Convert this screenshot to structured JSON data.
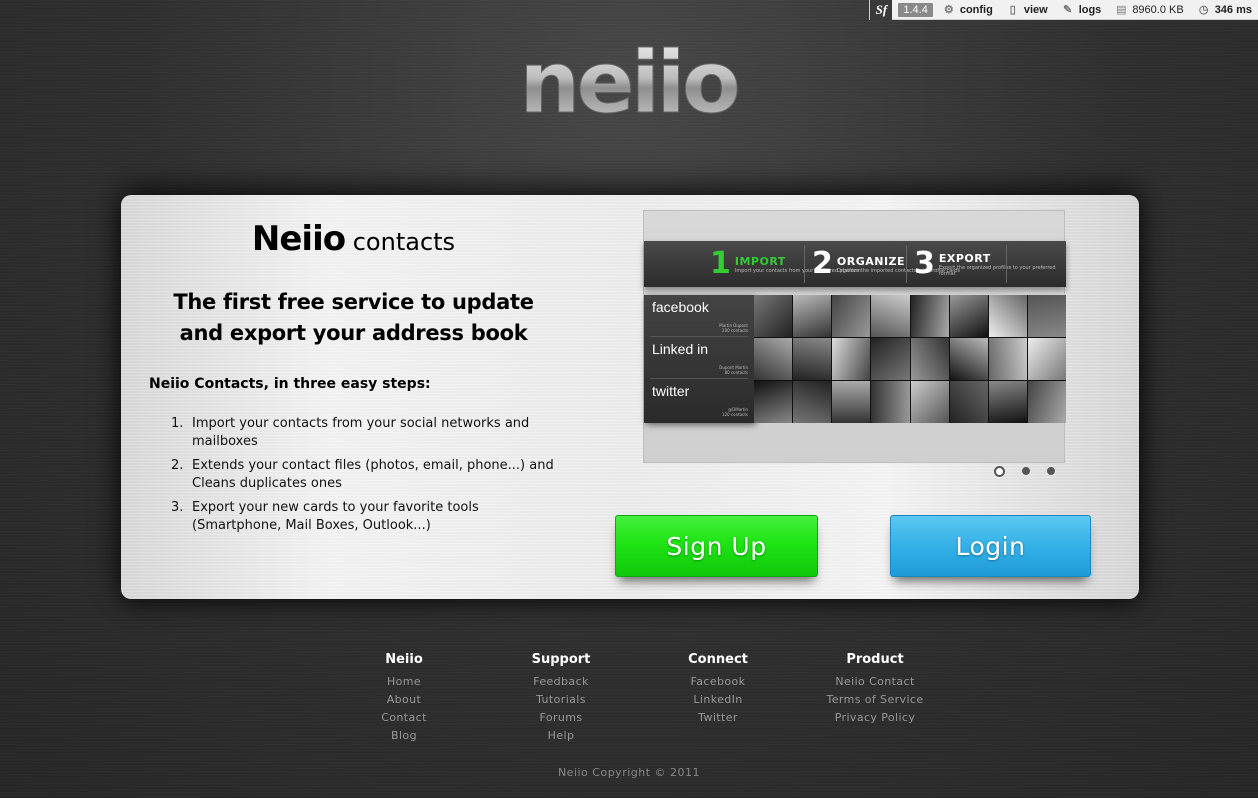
{
  "debug_toolbar": {
    "logo": "Sf",
    "version": "1.4.4",
    "config": "config",
    "view": "view",
    "logs": "logs",
    "memory": "8960.0 KB",
    "time": "346 ms"
  },
  "brand": {
    "logo_text": "neiio"
  },
  "panel": {
    "title_big": "Neiio",
    "title_small": " contacts",
    "headline": "The first free service to update and export your address book",
    "steps_title": "Neiio Contacts, in three easy steps:",
    "steps": [
      {
        "num": "1.",
        "text": "Import your contacts from your social networks and mailboxes"
      },
      {
        "num": "2.",
        "text": "Extends your contact files (photos, email, phone...) and Cleans duplicates ones"
      },
      {
        "num": "3.",
        "text": "Export your new cards to your favorite tools (Smartphone, Mail Boxes, Outlook...)"
      }
    ]
  },
  "slideshow": {
    "steps": [
      {
        "num": "1",
        "title": "Import",
        "sub": "Import your contacts from your preferred platform"
      },
      {
        "num": "2",
        "title": "Organize",
        "sub": "Organize the imported contacts into profile cards"
      },
      {
        "num": "3",
        "title": "Export",
        "sub": "Export the organized profiles to your preferred format"
      }
    ],
    "networks": [
      {
        "name": "facebook",
        "sub1": "Martin Dupont",
        "sub2": "200 contacts"
      },
      {
        "name": "Linked in",
        "sub1": "Dupont Martin",
        "sub2": "80 contacts"
      },
      {
        "name": "twitter",
        "sub1": "@DMartin",
        "sub2": "120 contacts"
      }
    ],
    "active_slide": 1,
    "slide_count": 3
  },
  "buttons": {
    "signup": "Sign Up",
    "login": "Login"
  },
  "footer": {
    "columns": [
      {
        "title": "Neiio",
        "links": [
          "Home",
          "About",
          "Contact",
          "Blog"
        ]
      },
      {
        "title": "Support",
        "links": [
          "Feedback",
          "Tutorials",
          "Forums",
          "Help"
        ]
      },
      {
        "title": "Connect",
        "links": [
          "Facebook",
          "LinkedIn",
          "Twitter"
        ]
      },
      {
        "title": "Product",
        "links": [
          "Neiio Contact",
          "Terms of Service",
          "Privacy Policy"
        ]
      }
    ],
    "copyright": "Neiio Copyright © 2011"
  },
  "colors": {
    "signup": "#1ee414",
    "login": "#33b0e6",
    "background": "#2f2f2f"
  }
}
